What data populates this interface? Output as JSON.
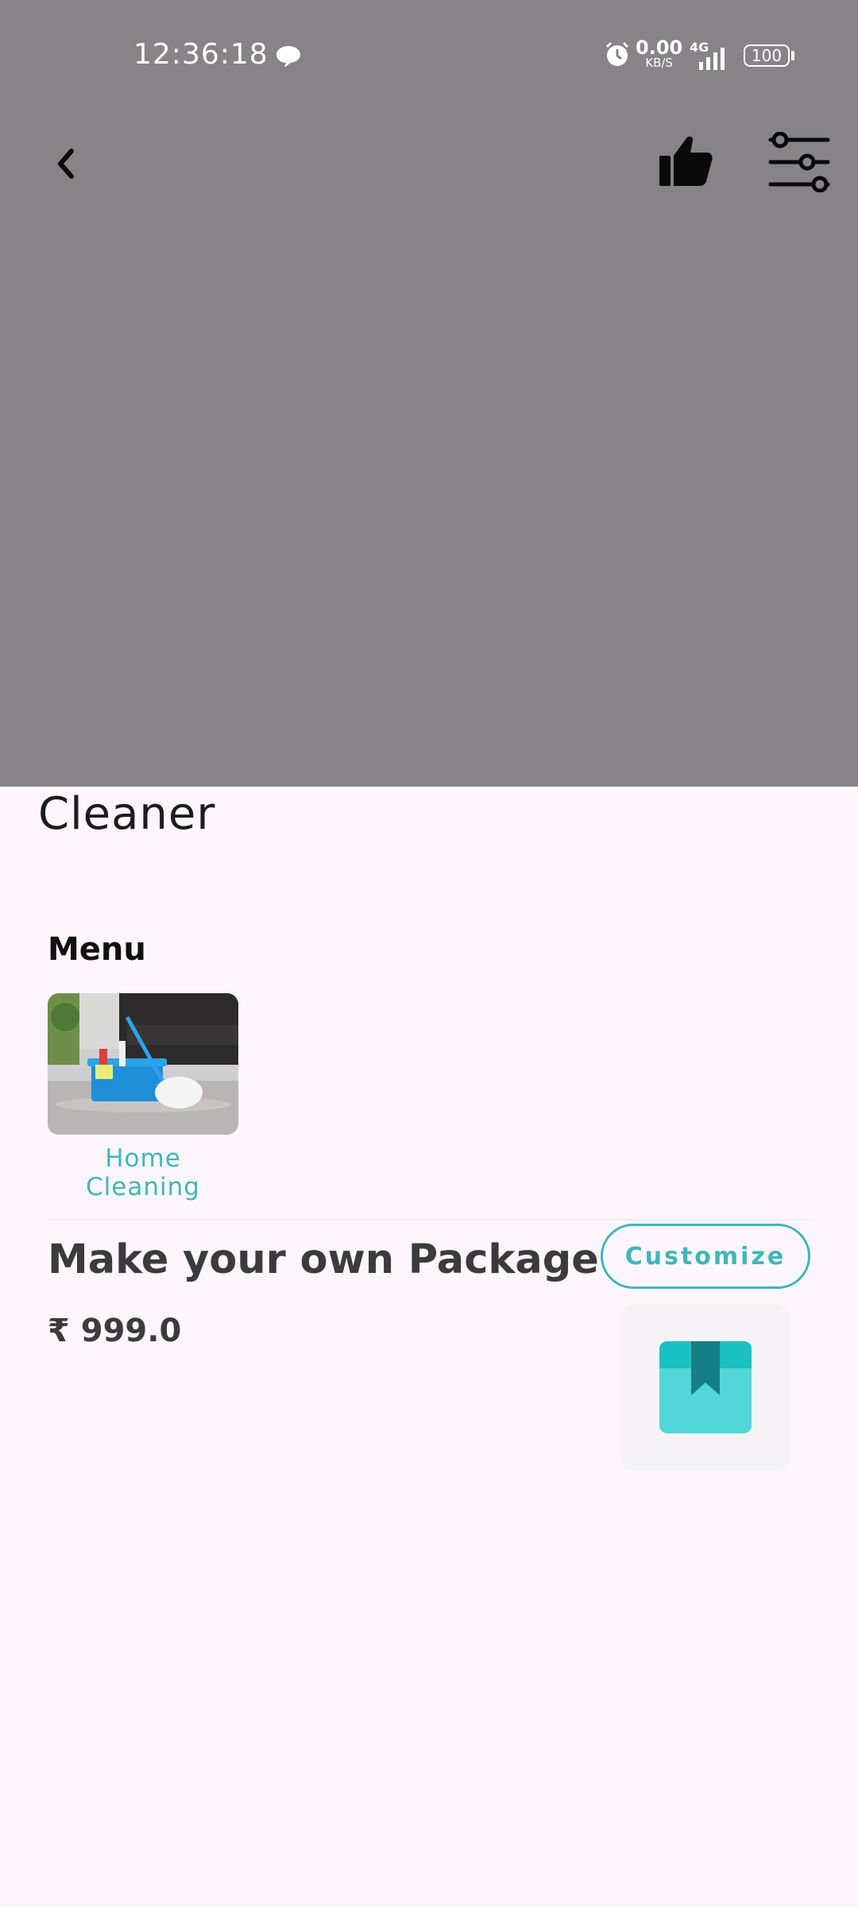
{
  "status_bar": {
    "time": "12:36:18",
    "net_speed_value": "0.00",
    "net_speed_unit": "KB/S",
    "network": "4G",
    "battery": "100"
  },
  "header": {
    "back_icon": "chevron-left-icon",
    "like_icon": "thumbs-up-icon",
    "filter_icon": "sliders-icon"
  },
  "page": {
    "title": "Cleaner"
  },
  "menu": {
    "heading": "Menu",
    "items": [
      {
        "label": "Home Cleaning",
        "image": "cleaning-supplies-photo"
      }
    ]
  },
  "package": {
    "title": "Make your own Package",
    "price": "₹ 999.0",
    "customize_label": "Customize",
    "icon": "bookmark-box-icon"
  },
  "colors": {
    "accent": "#3fb7b8",
    "hero_overlay": "#878387",
    "background": "#fcf5fc"
  }
}
